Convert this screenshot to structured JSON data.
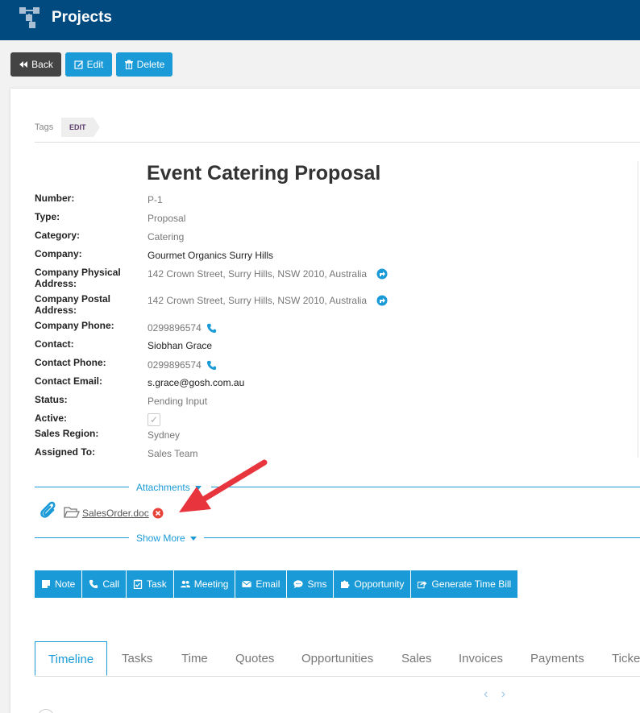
{
  "header": {
    "title": "Projects",
    "logo_icon": "hierarchy-icon"
  },
  "actions": {
    "back": "Back",
    "edit": "Edit",
    "delete": "Delete"
  },
  "tags": {
    "label": "Tags",
    "edit": "EDIT"
  },
  "record": {
    "title": "Event Catering Proposal",
    "fields": [
      {
        "label": "Number:",
        "value": "P-1"
      },
      {
        "label": "Type:",
        "value": "Proposal"
      },
      {
        "label": "Category:",
        "value": "Catering"
      },
      {
        "label": "Company:",
        "value": "Gourmet Organics Surry Hills"
      },
      {
        "label": "Company Physical Address:",
        "value": "142 Crown Street, Surry Hills, NSW 2010, Australia"
      },
      {
        "label": "Company Postal Address:",
        "value": "142 Crown Street, Surry Hills, NSW 2010, Australia"
      },
      {
        "label": "Company Phone:",
        "value": "0299896574"
      },
      {
        "label": "Contact:",
        "value": "Siobhan Grace"
      },
      {
        "label": "Contact Phone:",
        "value": "0299896574"
      },
      {
        "label": "Contact Email:",
        "value": "s.grace@gosh.com.au"
      },
      {
        "label": "Status:",
        "value": "Pending Input"
      },
      {
        "label": "Active:",
        "value": "✓"
      },
      {
        "label": "Sales Region:",
        "value": "Sydney"
      },
      {
        "label": "Assigned To:",
        "value": "Sales Team"
      }
    ]
  },
  "attachments": {
    "label": "Attachments",
    "file": "SalesOrder.doc"
  },
  "show_more": "Show More",
  "toolbar": [
    {
      "label": "Note",
      "icon": "note-icon"
    },
    {
      "label": "Call",
      "icon": "phone-icon"
    },
    {
      "label": "Task",
      "icon": "clipboard-check-icon"
    },
    {
      "label": "Meeting",
      "icon": "users-icon"
    },
    {
      "label": "Email",
      "icon": "envelope-icon"
    },
    {
      "label": "Sms",
      "icon": "chat-bubble-icon"
    },
    {
      "label": "Opportunity",
      "icon": "puzzle-icon"
    },
    {
      "label": "Generate Time Bill",
      "icon": "share-icon"
    }
  ],
  "tabs": [
    "Timeline",
    "Tasks",
    "Time",
    "Quotes",
    "Opportunities",
    "Sales",
    "Invoices",
    "Payments",
    "Ticke"
  ],
  "pager": "‹ ›",
  "colors": {
    "header": "#004a80",
    "accent": "#1a9ad6",
    "back_button": "#444444",
    "arrow": "#e8343d"
  }
}
